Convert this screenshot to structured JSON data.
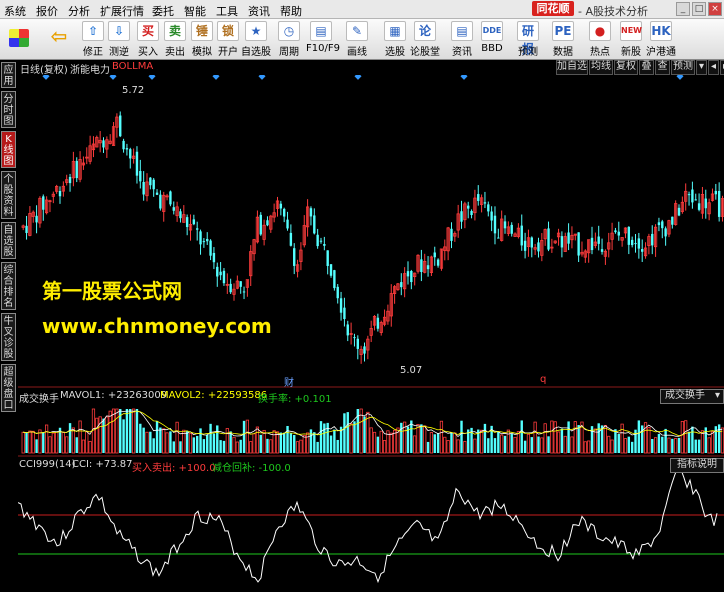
{
  "menubar": {
    "items": [
      "系统",
      "报价",
      "分析",
      "扩展行情",
      "委托",
      "智能",
      "工具",
      "资讯",
      "帮助"
    ],
    "brand": "同花顺",
    "title": "- A股技术分析"
  },
  "toolbar": {
    "buttons": [
      {
        "label": "修正",
        "icon": "⇧",
        "color": "#2d7ad6"
      },
      {
        "label": "测逆",
        "icon": "⇩",
        "color": "#2d7ad6"
      },
      {
        "label": "买入",
        "icon": "买",
        "color": "#d32020"
      },
      {
        "label": "卖出",
        "icon": "卖",
        "color": "#2a8a2a"
      },
      {
        "label": "模拟",
        "icon": "锤",
        "color": "#b07020"
      },
      {
        "label": "开户",
        "icon": "锁",
        "color": "#b07020"
      },
      {
        "label": "自选股",
        "icon": "★",
        "color": "#2d63c0"
      },
      {
        "label": "周期",
        "icon": "◷",
        "color": "#2d63c0"
      },
      {
        "label": "F10/F9",
        "icon": "▤",
        "color": "#2d63c0"
      },
      {
        "label": "画线",
        "icon": "✎",
        "color": "#2d63c0"
      },
      {
        "label": "选股",
        "icon": "▦",
        "color": "#2d63c0"
      },
      {
        "label": "论股堂",
        "icon": "论",
        "color": "#2d63c0"
      },
      {
        "label": "资讯",
        "icon": "▤",
        "color": "#2d63c0"
      },
      {
        "label": "BBD",
        "icon": "DDE",
        "color": "#2d63c0"
      },
      {
        "label": "预测",
        "icon": "研报",
        "color": "#2d63c0"
      },
      {
        "label": "数据",
        "icon": "PE",
        "color": "#2d63c0"
      },
      {
        "label": "热点",
        "icon": "●",
        "color": "#d32020"
      },
      {
        "label": "新股",
        "icon": "NEW",
        "color": "#d32020"
      },
      {
        "label": "沪港通",
        "icon": "HK",
        "color": "#2d63c0"
      }
    ]
  },
  "sidebar": {
    "tabs": [
      "应用",
      "分时图",
      "K线图",
      "个股资料",
      "自选股",
      "综合排名",
      "牛叉诊股",
      "超级盘口"
    ],
    "active": "K线图"
  },
  "chart_header": {
    "period": "日线(复权)",
    "stock": "浙能电力",
    "indicator": "BOLLMA",
    "buttons": [
      "加自选",
      "均线",
      "复权",
      "叠",
      "查",
      "预测"
    ]
  },
  "main_chart": {
    "high_label": "5.72",
    "low_label": "5.07",
    "fin_marker": "财",
    "q_marker": "q"
  },
  "volume_panel": {
    "name": "成交换手",
    "mavol1_label": "MAVOL1: +23263009",
    "mavol2_label": "MAVOL2: +22593586",
    "turnover_label": "换手率: +0.101",
    "dropdown": "成交换手"
  },
  "indicator_panel": {
    "name": "CCI999(14)",
    "cci_label": "CCI: +73.87",
    "buy_label": "买入卖出: +100.0",
    "sell_label": "减仓回补: -100.0",
    "button": "指标说明"
  },
  "watermark": {
    "line1": "第一股票公式网",
    "line2": "www.chnmoney.com"
  },
  "colors": {
    "up": "#ff3c3c",
    "down": "#54ffff",
    "ma1": "#ffffff",
    "ma2": "#ffff00",
    "cci": "#ffffff",
    "upper_line": "#c81e1e",
    "lower_line": "#1ec81e"
  }
}
